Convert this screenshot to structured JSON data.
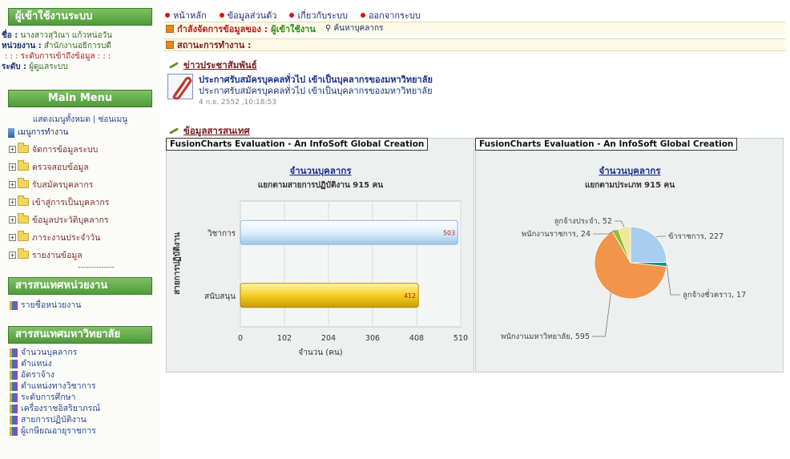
{
  "sidebar": {
    "user_panel": {
      "title": "ผู้เข้าใช้งานระบบ",
      "name_label": "ชื่อ :",
      "name_value": "นางสาวสุวิณา แก้วหน่อวัน",
      "unit_label": "หน่วยงาน :",
      "unit_value": "สำนักงานอธิการบดี",
      "access_heading": ": : : ระดับการเข้าถึงข้อมูล : : :",
      "level_label": "ระดับ :",
      "level_value": "ผู้ดูแลระบบ"
    },
    "main_menu": {
      "title": "Main Menu",
      "show_all": "แสดงเมนูทั้งหมด",
      "separator": "|",
      "hide_menu": "ซ่อนเมนู",
      "root": "เมนูการทำงาน",
      "items": [
        {
          "label": "จัดการข้อมูลระบบ"
        },
        {
          "label": "ตรวจสอบข้อมูล"
        },
        {
          "label": "รับสมัครบุคลากร"
        },
        {
          "label": "เข้าสู่การเป็นบุคลากร"
        },
        {
          "label": "ข้อมูลประวัติบุคลากร"
        },
        {
          "label": "ภาระงานประจำวัน"
        },
        {
          "label": "รายงานข้อมูล"
        }
      ],
      "divider": "--------------"
    },
    "unit_info": {
      "title": "สารสนเทศหน่วยงาน",
      "items": [
        {
          "label": "รายชื่อหน่วยงาน"
        }
      ]
    },
    "univ_info": {
      "title": "สารสนเทศมหาวิทยาลัย",
      "items": [
        {
          "label": "จำนวนบุคลากร"
        },
        {
          "label": "ตำแหน่ง"
        },
        {
          "label": "อัตราจ้าง"
        },
        {
          "label": "ตำแหน่งทางวิชาการ"
        },
        {
          "label": "ระดับการศึกษา"
        },
        {
          "label": "เครื่องราชอิสริยาภรณ์"
        },
        {
          "label": "สายการปฏิบัติงาน"
        },
        {
          "label": "ผู้เกษียณอายุราชการ"
        }
      ]
    }
  },
  "topnav": {
    "items": [
      {
        "label": "หน้าหลัก"
      },
      {
        "label": "ข้อมูลส่วนตัว"
      },
      {
        "label": "เกี่ยวกับระบบ"
      },
      {
        "label": "ออกจากระบบ"
      }
    ]
  },
  "status": {
    "managing_label": "กำลังจัดการข้อมูลของ :",
    "managing_value": "ผู้เข้าใช้งาน",
    "search_label": "ค้นหาบุคลากร",
    "work_status_label": "สถานะการทำงาน :"
  },
  "news": {
    "section_title": "ข่าวประชาสัมพันธ์",
    "headline": "ประกาศรับสมัครบุคคลทั่วไป เข้าเป็นบุคลากรของมหาวิทยาลัย",
    "body": "ประกาศรับสมัครบุคคลทั่วไป เข้าเป็นบุคลากรของมหาวิทยาลัย",
    "date": "4 ก.ย. 2552 ,10:18:53"
  },
  "info_section_title": "ข้อมูลสารสนเทศ",
  "colors": {
    "sidebar_header": "#5aa646",
    "nav_bullet": "#dd1111",
    "bar_series_1": "#bcd8f0",
    "bar_series_2": "#e8c21c",
    "pie_orange": "#f0954a",
    "pie_blue": "#a9cdee"
  },
  "chart_data": [
    {
      "caption": "FusionCharts Evaluation - An InfoSoft Global Creation",
      "type": "bar",
      "orientation": "horizontal",
      "title": "จำนวนบุคลากร",
      "subtitle": "แยกตามสายการปฏิบัติงาน 915 คน",
      "xlabel": "จำนวน (คน)",
      "ylabel": "สายการปฏิบัติงาน",
      "categories": [
        "วิชาการ",
        "สนับสนุน"
      ],
      "values": [
        503,
        412
      ],
      "xlim": [
        0,
        510
      ],
      "ticks": [
        0,
        102,
        204,
        306,
        408,
        510
      ]
    },
    {
      "caption": "FusionCharts Evaluation - An InfoSoft Global Creation",
      "type": "pie",
      "title": "จำนวนบุคลากร",
      "subtitle": "แยกตามประเภท 915 คน",
      "slices": [
        {
          "label": "ข้าราชการ, 227",
          "value": 227,
          "color": "#a9cdee"
        },
        {
          "label": "ลูกจ้างชั่วคราว, 17",
          "value": 17,
          "color": "#1f8a8a"
        },
        {
          "label": "พนักงานมหาวิทยาลัย, 595",
          "value": 595,
          "color": "#f0954a"
        },
        {
          "label": "พนักงานราชการ, 24",
          "value": 24,
          "color": "#8fbf2a"
        },
        {
          "label": "ลูกจ้างประจำ, 52",
          "value": 52,
          "color": "#efe89a"
        }
      ]
    }
  ]
}
